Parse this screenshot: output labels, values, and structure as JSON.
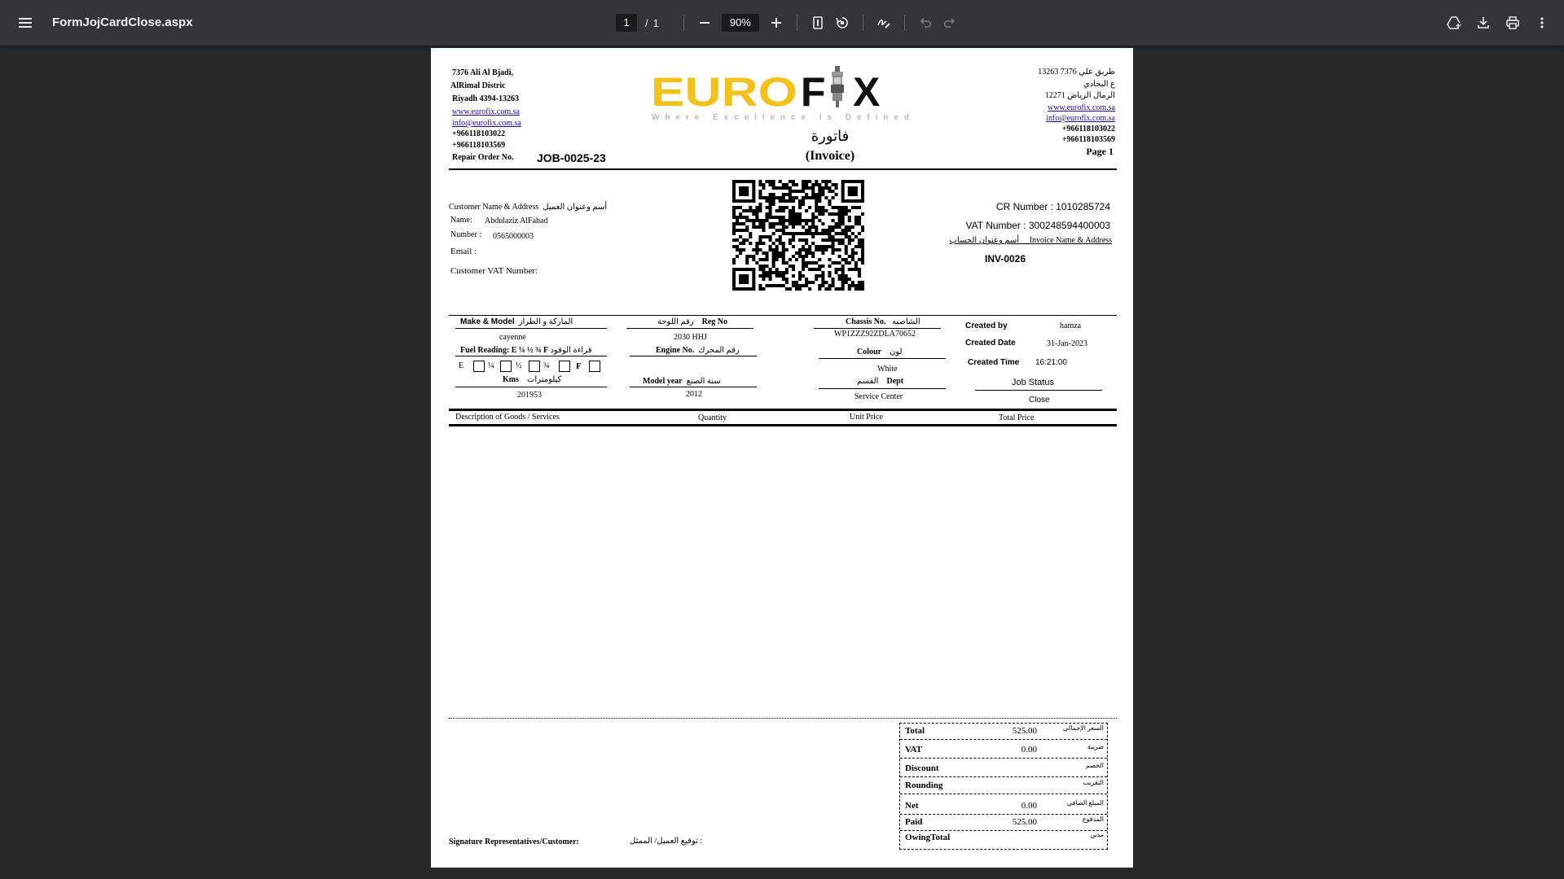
{
  "viewer": {
    "title": "FormJojCardClose.aspx",
    "page_current": "1",
    "page_separator": "/",
    "page_total": "1",
    "zoom": "90%"
  },
  "invoice": {
    "left_address": [
      "7376 Ali Al Bjadi,",
      "AlRimal Distric",
      "Riyadh 4394-13263"
    ],
    "website": "www.eurofix.com.sa",
    "email": "info@eurofix.com.sa",
    "phone1": "+966118103022",
    "phone2": "+966118103569",
    "repair_order_label": "Repair Order No.",
    "repair_order_no": "JOB-0025-23",
    "logo_euro": "EURO",
    "logo_f": "F",
    "logo_x": "X",
    "tagline": "Where Excellence Is Defined",
    "title_ar": "فاتورة",
    "title_en": "(Invoice)",
    "right_address": [
      "طريق علي 7376 13263",
      "ع البجادي",
      "الرمال الرياض 12271"
    ],
    "page_label": "Page 1",
    "customer_label": "Customer Name & Address",
    "customer_label_ar": "أسم وعنوان العميل",
    "name_label": "Name:",
    "name_value": "Abdulaziz AlFahad",
    "number_label": "Number :",
    "number_value": "0565000003",
    "email_label": "Email :",
    "vat_number_label": "Customer VAT Number:",
    "cr_number": "CR Number : 1010285724",
    "vat_number": "VAT Number : 300248594400003",
    "invoice_name_label": "Invoice Name & Address",
    "invoice_name_label_ar": "أسم وعنوان الحساب",
    "invoice_no": "INV-0026",
    "make_model_label": "Make & Model",
    "make_model_label_ar": "الماركة و الطراز",
    "make_model": "cayenne",
    "fuel_label": "Fuel Reading: E ¼ ½ ¾ F",
    "fuel_label_ar": "قراءة الوقود",
    "fuel_e": "E",
    "fuel_q": "¼",
    "fuel_h": "½",
    "fuel_tq": "¾",
    "fuel_f": "F",
    "kms_label": "Kms",
    "kms_label_ar": "كيلومترات",
    "kms": "201953",
    "reg_label": "Reg No",
    "reg_label_ar": "رقم اللوحة",
    "reg_no": "2030 HHJ",
    "engine_label": "Engine No.",
    "engine_label_ar": "رقم المحرك",
    "model_year_label": "Model year",
    "model_year_label_ar": "سنة الصنع",
    "model_year": "2012",
    "chassis_label": "Chassis No.",
    "chassis_label_ar": "الشاصيه",
    "chassis": "WP1ZZZ92ZDLA70652",
    "colour_label": "Colour",
    "colour_label_ar": "لون",
    "colour": "White",
    "dept_label": "Dept",
    "dept_label_ar": "القسم",
    "dept": "Service Center",
    "created_by_label": "Created by",
    "created_by": "hamza",
    "created_date_label": "Created Date",
    "created_date": "31-Jan-2023",
    "created_time_label": "Created  Time",
    "created_time": "16:21:00",
    "job_status_label": "Job Status",
    "job_status": "Close",
    "col_desc": "Description of Goods / Services",
    "col_qty": "Quantity",
    "col_unit": "Unit Price",
    "col_total": "Total Price",
    "signature_label": "Signature Representatives/Customer:",
    "signature_label_ar": "توقيع العميل/ الممثل :",
    "totals": [
      {
        "label": "Total",
        "value": "525.00",
        "ar": "السعر الإجمالي"
      },
      {
        "label": "VAT",
        "value": "0.00",
        "ar": "ضريبة"
      },
      {
        "label": "Discount",
        "value": "",
        "ar": "الخصم"
      },
      {
        "label": "Rounding",
        "value": "",
        "ar": "التقريب"
      },
      {
        "label": "Net",
        "value": "0.00",
        "ar": "المبلغ الصافي"
      },
      {
        "label": "Paid",
        "value": "525.00",
        "ar": "المدفوع"
      },
      {
        "label": "OwingTotal",
        "value": "",
        "ar": "مدين"
      }
    ]
  },
  "icons": [
    "menu-icon",
    "zoom-out-icon",
    "zoom-in-icon",
    "fit-page-icon",
    "rotate-icon",
    "annotate-icon",
    "undo-icon",
    "redo-icon",
    "drive-save-icon",
    "download-icon",
    "print-icon",
    "more-vert-icon"
  ]
}
